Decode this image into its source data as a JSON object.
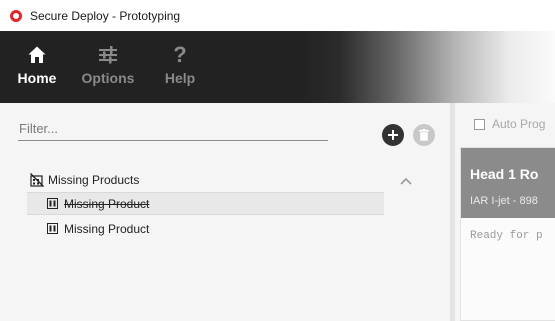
{
  "window": {
    "title": "Secure Deploy - Prototyping"
  },
  "nav": {
    "home": {
      "label": "Home",
      "icon": "home-icon"
    },
    "options": {
      "label": "Options",
      "icon": "sliders-icon"
    },
    "help": {
      "label": "Help",
      "icon": "question-icon",
      "glyph": "?"
    }
  },
  "filter": {
    "placeholder": "Filter...",
    "value": ""
  },
  "actions": {
    "add": "add-icon",
    "delete": "trash-icon"
  },
  "tree": {
    "group": {
      "label": "Missing Products",
      "icon": "missing-products-icon"
    },
    "items": [
      {
        "label": "Missing Product",
        "struck": true,
        "selected": true,
        "icon": "product-icon"
      },
      {
        "label": "Missing Product",
        "struck": false,
        "selected": false,
        "icon": "product-icon"
      }
    ]
  },
  "right": {
    "auto_prog_label": "Auto Prog",
    "head": {
      "title": "Head 1   Ro",
      "subtitle": "IAR I-jet - 898",
      "status": "Ready for p"
    }
  },
  "colors": {
    "ribbon": "#222222",
    "accent_red": "#e0262b",
    "head_header": "#8b8b8b"
  }
}
